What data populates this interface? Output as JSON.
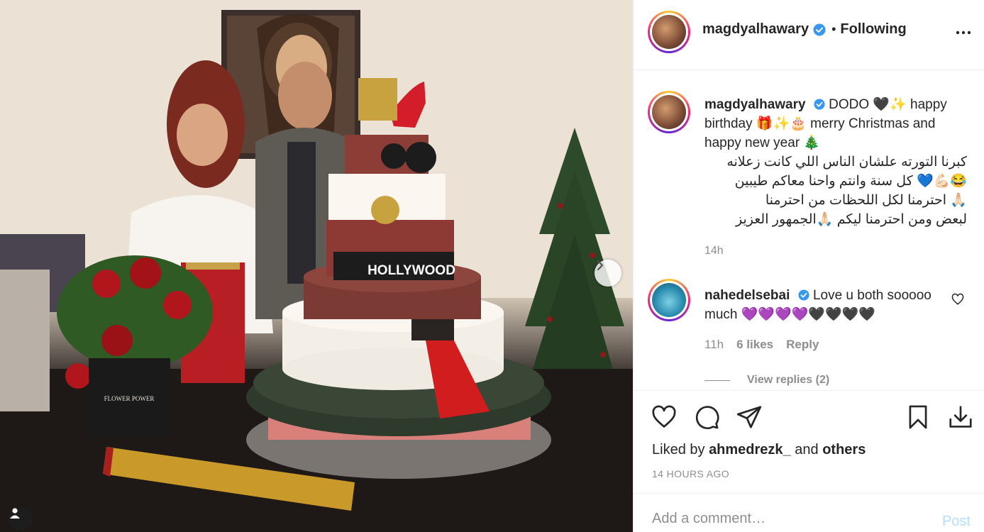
{
  "post": {
    "author": "magdyalhawary",
    "follow_status": "Following",
    "dot": "•"
  },
  "caption": {
    "author": "magdyalhawary",
    "line1": "DODO 🖤✨ happy birthday 🎁✨🎂 merry Christmas and happy new year 🎄",
    "line2": "كبرنا التورته علشان الناس اللي كانت زعلانه",
    "line3": "😂💪🏻💙 كل سنة وانتم واحنا معاكم طيبين",
    "line4": "🙏🏻 احترمنا لكل اللحظات من احترمنا",
    "line5": "لبعض ومن احترمنا ليكم 🙏🏻الجمهور العزيز",
    "time": "14h"
  },
  "comment": {
    "author": "nahedelsebai",
    "text": "Love u both sooooo much 💜💜💜💜🖤🖤🖤🖤",
    "time": "11h",
    "likes": "6 likes",
    "reply": "Reply",
    "view_replies": "View replies (2)"
  },
  "actions": {
    "liked_prefix": "Liked by",
    "liked_user": "ahmedrezk_",
    "liked_and": "and",
    "liked_others": "others",
    "timestamp": "14 HOURS AGO"
  },
  "add_comment": {
    "placeholder": "Add a comment…",
    "post_label": "Post"
  },
  "photo": {
    "cake_sign": "HOLLYWOOD",
    "box_label": "FLOWER POWER"
  },
  "colors": {
    "verified": "#3897f0",
    "post_disabled": "#b2dffc",
    "muted": "#8e8e8e"
  },
  "icons": [
    "verified-icon",
    "more-options-icon",
    "heart-icon",
    "comment-icon",
    "share-icon",
    "bookmark-icon",
    "download-icon",
    "chevron-right-icon",
    "user-tag-icon"
  ]
}
